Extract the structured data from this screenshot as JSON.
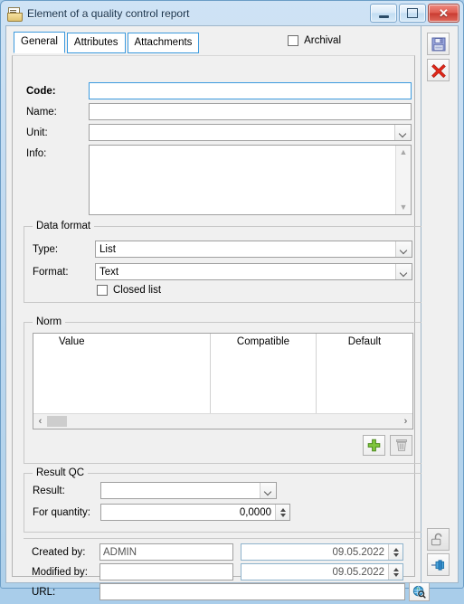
{
  "window": {
    "title": "Element of a quality control report",
    "icon": "document-folder-icon",
    "minimize_label": "Minimize",
    "maximize_label": "Maximize",
    "close_label": "Close"
  },
  "tabs": [
    {
      "label": "General",
      "active": true
    },
    {
      "label": "Attributes",
      "active": false
    },
    {
      "label": "Attachments",
      "active": false
    }
  ],
  "archival": {
    "label": "Archival",
    "checked": false
  },
  "fields": {
    "code": {
      "label": "Code:",
      "value": "",
      "focused": true
    },
    "name": {
      "label": "Name:",
      "value": ""
    },
    "unit": {
      "label": "Unit:",
      "value": ""
    },
    "info": {
      "label": "Info:",
      "value": ""
    }
  },
  "data_format": {
    "caption": "Data format",
    "type": {
      "label": "Type:",
      "value": "List"
    },
    "format": {
      "label": "Format:",
      "value": "Text"
    },
    "closed_list": {
      "label": "Closed list",
      "checked": false
    }
  },
  "norm": {
    "caption": "Norm",
    "columns": [
      "Value",
      "Compatible",
      "Default"
    ],
    "rows": [],
    "add_label": "Add",
    "delete_label": "Delete",
    "hscroll": {
      "left_arrow": "‹",
      "right_arrow": "›"
    }
  },
  "result_qc": {
    "caption": "Result QC",
    "result": {
      "label": "Result:",
      "value": ""
    },
    "for_quantity": {
      "label": "For quantity:",
      "value": "0,0000"
    }
  },
  "audit": {
    "created_by": {
      "label": "Created by:",
      "value": "ADMIN",
      "date": "09.05.2022"
    },
    "modified_by": {
      "label": "Modified by:",
      "value": "",
      "date": "09.05.2022"
    },
    "url": {
      "label": "URL:",
      "value": ""
    }
  },
  "sidebar": {
    "save": {
      "name": "save-button",
      "tooltip": "Save"
    },
    "cancel": {
      "name": "cancel-button",
      "tooltip": "Cancel"
    },
    "lock": {
      "name": "unlock-button",
      "tooltip": "Unlock"
    },
    "pin": {
      "name": "pin-button",
      "tooltip": "Pin"
    }
  },
  "colors": {
    "window_border": "#6b9dc6",
    "tab_border": "#3c9ade",
    "focus_border": "#3c9ade",
    "close_button": "#c93b31",
    "add_icon": "#6cba2f",
    "client_bg": "#f0f0f0"
  }
}
